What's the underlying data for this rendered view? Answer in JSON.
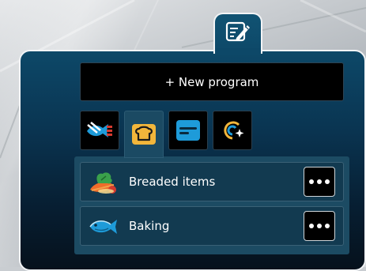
{
  "header": {
    "edit_icon": "edit-note-icon"
  },
  "toolbar": {
    "new_program_label": "+ New program"
  },
  "categories": [
    {
      "icon": "fish-grill-icon",
      "active": false
    },
    {
      "icon": "bread-icon",
      "active": true
    },
    {
      "icon": "tray-icon",
      "active": false
    },
    {
      "icon": "spiral-sparkle-icon",
      "active": false
    }
  ],
  "programs": [
    {
      "label": "Breaded items",
      "icon": "vegetables-icon"
    },
    {
      "label": "Baking",
      "icon": "fish-icon"
    }
  ],
  "colors": {
    "accent_yellow": "#f2b63b",
    "accent_blue": "#1e9bd9",
    "accent_red": "#d63a2f",
    "panel_top": "#0d4868",
    "panel_bottom": "#06111c"
  }
}
